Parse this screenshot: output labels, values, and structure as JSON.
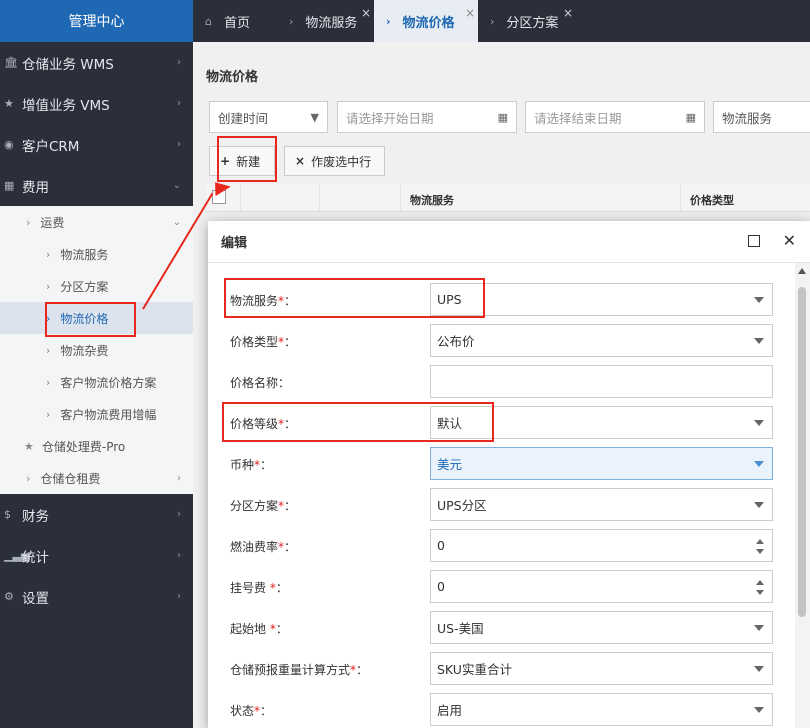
{
  "sidebar": {
    "title": "管理中心",
    "items": [
      {
        "label": "仓储业务 WMS"
      },
      {
        "label": "增值业务 VMS"
      },
      {
        "label": "客户CRM"
      },
      {
        "label": "费用"
      }
    ],
    "sub": {
      "freight": "运费",
      "children": [
        "物流服务",
        "分区方案",
        "物流价格",
        "物流杂费",
        "客户物流价格方案",
        "客户物流费用增幅"
      ],
      "storage_pro": "仓储处理费-Pro",
      "storage_rent": "仓储仓租费"
    },
    "bottom": [
      {
        "label": "财务"
      },
      {
        "label": "统计"
      },
      {
        "label": "设置"
      }
    ]
  },
  "tabs": [
    {
      "label": "首页"
    },
    {
      "label": "物流服务"
    },
    {
      "label": "物流价格"
    },
    {
      "label": "分区方案"
    }
  ],
  "panel": {
    "title": "物流价格",
    "filters": {
      "time_type": "创建时间",
      "start_placeholder": "请选择开始日期",
      "end_placeholder": "请选择结束日期",
      "service": "物流服务"
    },
    "buttons": {
      "new": "新建",
      "void": "作废选中行"
    },
    "columns": [
      "物流服务",
      "价格类型"
    ]
  },
  "dialog": {
    "title": "编辑",
    "fields": [
      {
        "label": "物流服务",
        "sep": "：",
        "required": true,
        "value": "UPS",
        "kind": "select"
      },
      {
        "label": "价格类型",
        "sep": "：",
        "required": true,
        "value": "公布价",
        "kind": "select"
      },
      {
        "label": "价格名称",
        "sep": "：",
        "required": false,
        "value": "",
        "kind": "text"
      },
      {
        "label": "价格等级",
        "sep": "：",
        "required": true,
        "value": "默认",
        "kind": "select"
      },
      {
        "label": "币种",
        "sep": "：",
        "required": true,
        "value": "美元",
        "kind": "select"
      },
      {
        "label": "分区方案",
        "sep": "：",
        "required": true,
        "value": "UPS分区",
        "kind": "select"
      },
      {
        "label": "燃油费率",
        "sep": "：",
        "required": true,
        "value": "0",
        "kind": "number"
      },
      {
        "label": "挂号费 ",
        "sep": "：",
        "required": true,
        "value": "0",
        "kind": "number"
      },
      {
        "label": "起始地 ",
        "sep": "：",
        "required": true,
        "value": "US-美国",
        "kind": "select"
      },
      {
        "label": "仓储预报重量计算方式",
        "sep": "：",
        "required": true,
        "value": "SKU实重合计",
        "kind": "select"
      },
      {
        "label": "状态",
        "sep": "：",
        "required": true,
        "value": "启用",
        "kind": "select"
      }
    ]
  },
  "symbols": {
    "required_mark": "*",
    "plus": "+",
    "times": "×",
    "close_x": "✕",
    "tab_close": "×"
  },
  "colors": {
    "accent": "#1f68b3",
    "sidebar_bg": "#2b2f3a",
    "annotation": "#e8281c",
    "required": "#e02020"
  }
}
